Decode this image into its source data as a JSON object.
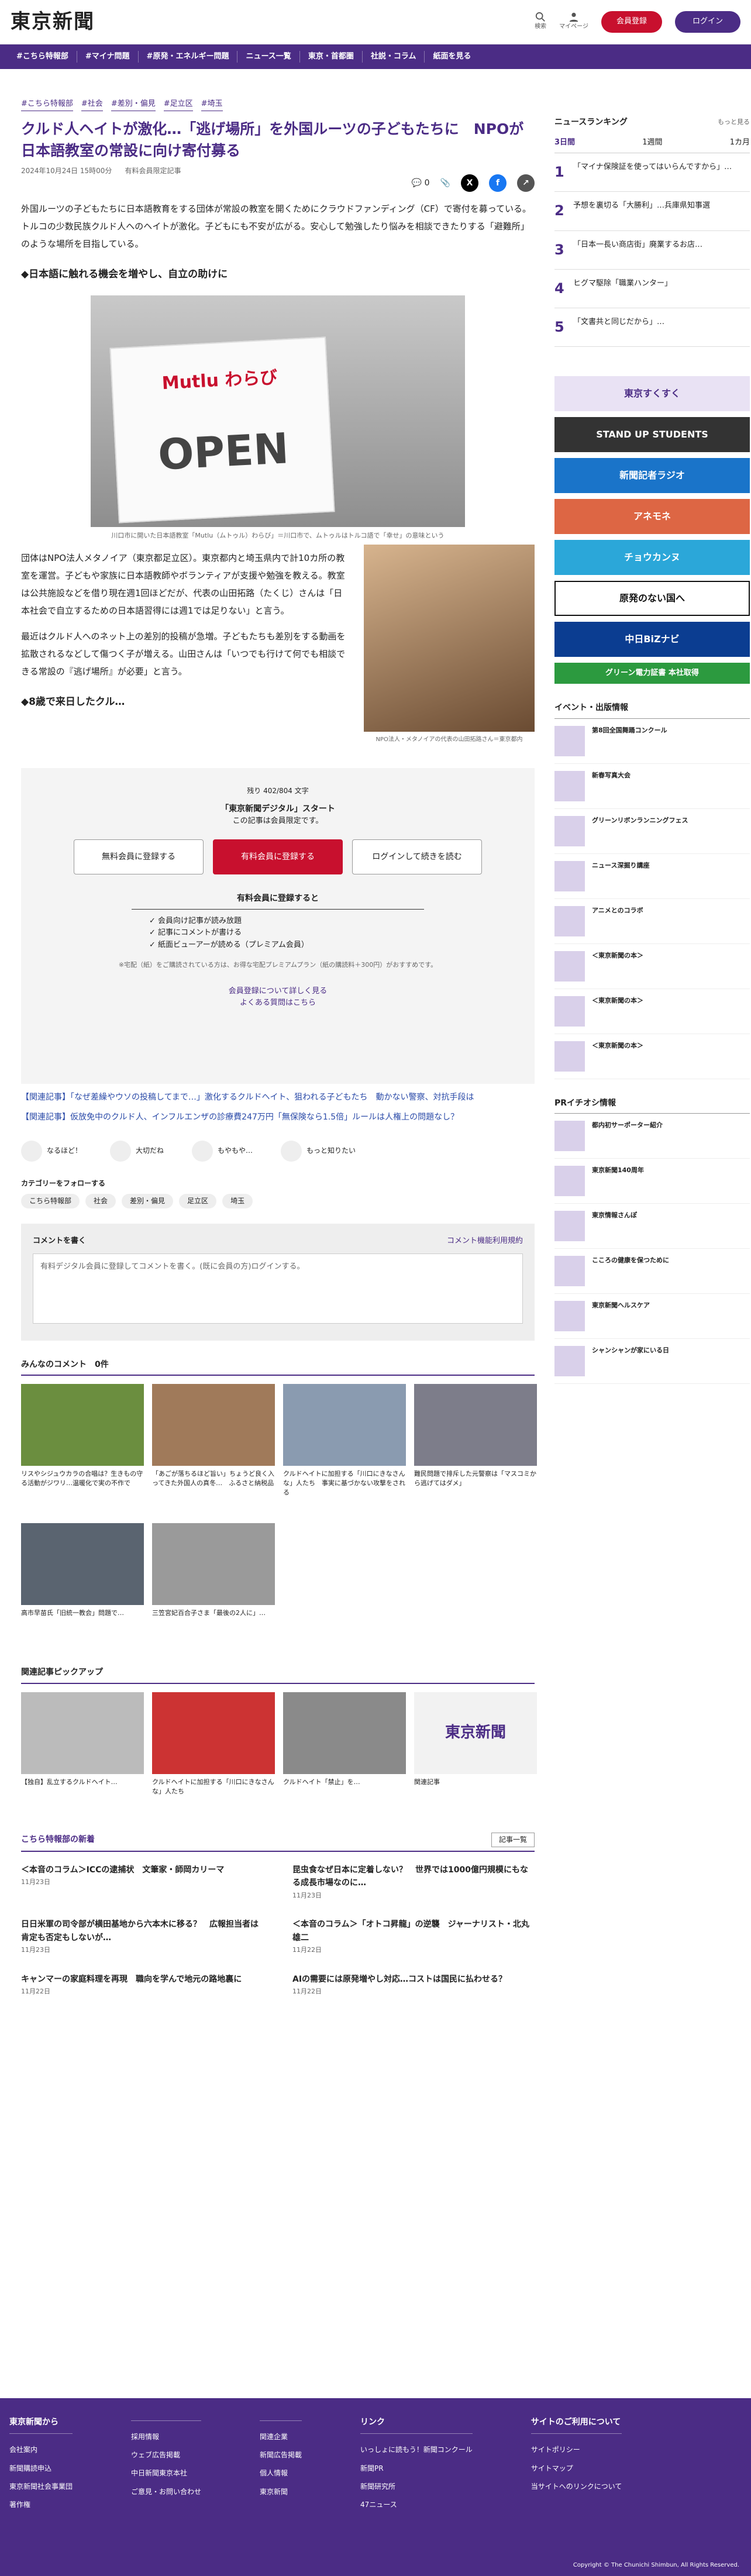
{
  "header": {
    "logo": "東京新聞",
    "search": "検索",
    "mypage": "マイページ",
    "register": "会員登録",
    "login": "ログイン"
  },
  "nav": [
    "#こちら特報部",
    "#マイナ問題",
    "#原発・エネルギー問題",
    "ニュース一覧",
    "東京・首都圏",
    "社説・コラム",
    "紙面を見る"
  ],
  "article": {
    "tags": [
      "#こちら特報部",
      "#社会",
      "#差別・偏見",
      "#足立区",
      "#埼玉"
    ],
    "title": "クルド人ヘイトが激化…「逃げ場所」を外国ルーツの子どもたちに　NPOが日本語教室の常設に向け寄付募る",
    "date": "2024年10月24日 15時00分",
    "limited": "有料会員限定記事",
    "comments": "0",
    "p1": "外国ルーツの子どもたちに日本語教育をする団体が常設の教室を開くためにクラウドファンディング（CF）で寄付を募っている。トルコの少数民族クルド人へのヘイトが激化。子どもにも不安が広がる。安心して勉強したり悩みを相談できたりする「避難所」のような場所を目指している。",
    "h1": "◆日本語に触れる機会を増やし、自立の助けに",
    "cap1": "川口市に開いた日本語教室「Mutlu（ムトゥル）わらび」＝川口市で、ムトゥルはトルコ語で「幸せ」の意味という",
    "p2": "団体はNPO法人メタノイア（東京都足立区）。東京都内と埼玉県内で計10カ所の教室を運営。子どもや家族に日本語教師やボランティアが支援や勉強を教える。教室は公共施設などを借り現在週1回ほどだが、代表の山田拓路（たくじ）さんは「日本社会で自立するための日本語習得には週1では足りない」と言う。",
    "p3": "最近はクルド人へのネット上の差別的投稿が急増。子どもたちも差別をする動画を拡散されるなどして傷つく子が増える。山田さんは「いつでも行けて何でも相談できる常設の『逃げ場所』が必要」と言う。",
    "cap2": "NPO法人・メタノイアの代表の山田拓路さん＝東京都内",
    "h2": "◆8歳で来日したクル…",
    "sign": "Mutlu わらび"
  },
  "paywall": {
    "remain": "残り 402/804 文字",
    "campaign": "「東京新聞デジタル」スタート",
    "note": "この記事は会員限定です。",
    "free": "無料会員に登録する",
    "paid": "有料会員に登録する",
    "login": "ログインして続きを読む",
    "benefits_title": "有料会員に登録すると",
    "benefits": [
      "会員向け記事が読み放題",
      "記事にコメントが書ける",
      "紙面ビューアーが読める（プレミアム会員）"
    ],
    "footnote": "※宅配（紙）をご購読されている方は、お得な宅配プレミアムプラン（紙の購読料＋300円）がおすすめです。",
    "more": "会員登録について詳しく見る",
    "faq": "よくある質問はこちら"
  },
  "related": [
    "【関連記事】「なぜ差繰やウソの投稿してまで…」激化するクルドヘイト、狙われる子どもたち　動かない警察、対抗手段は",
    "【関連記事】仮放免中のクルド人、インフルエンザの診療費247万円「無保険なら1.5倍」ルールは人権上の問題なし？"
  ],
  "reactions": [
    "なるほど！",
    "大切だね",
    "もやもや…",
    "もっと知りたい"
  ],
  "follow": {
    "title": "カテゴリーをフォローする",
    "chips": [
      "こちら特報部",
      "社会",
      "差別・偏見",
      "足立区",
      "埼玉"
    ]
  },
  "comment": {
    "title": "コメントを書く",
    "guide": "コメント機能利用規約",
    "hint": "有料デジタル会員に登録してコメントを書く。(既に会員の方)ログインする。"
  },
  "all_comments": "みんなのコメント　0件",
  "thumbs": [
    {
      "t": "リスやシジュウカラの合唱は？生きもの守る活動がジワリ…温暖化で実の不作で"
    },
    {
      "t": "「あごが落ちるほど旨い」ちょうど良く入ってきた外国人の真冬…　ふるさと納税品"
    },
    {
      "t": "クルドヘイトに加担する「川口にきなさんな」人たち　事実に基づかない攻撃をされる"
    },
    {
      "t": "難民問題で排斥した元警察は「マスコミから逃げてはダメ」"
    },
    {
      "t": "高市早苗氏「旧統一教会」問題で…"
    },
    {
      "t": "三笠宮妃百合子さま「最後の2人に」…"
    }
  ],
  "pickup": {
    "title": "関連記事ピックアップ",
    "items": [
      "【独自】乱立するクルドヘイト…",
      "クルドヘイトに加担する「川口にきなさんな」人たち",
      "クルドヘイト「禁止」を…",
      "関連記事"
    ]
  },
  "special": {
    "title": "こちら特報部の新着",
    "more": "記事一覧",
    "items": [
      {
        "h": "＜本音のコラム＞ICCの逮捕状　文筆家・師岡カリーマ",
        "d": "11月23日"
      },
      {
        "h": "昆虫食なぜ日本に定着しない？　世界では1000億円規模にもなる成長市場なのに…",
        "d": "11月23日"
      },
      {
        "h": "日日米軍の司令部が横田基地から六本木に移る？　広報担当者は肯定も否定もしないが…",
        "d": "11月23日"
      },
      {
        "h": "＜本音のコラム＞「オトコ昇龍」の逆襲　ジャーナリスト・北丸雄二",
        "d": "11月22日"
      },
      {
        "h": "キャンマーの家庭料理を再現　職向を学んで地元の路地裏に",
        "d": "11月22日"
      },
      {
        "h": "AIの需要には原発増やし対応…コストは国民に払わせる？",
        "d": "11月22日"
      }
    ]
  },
  "ranking": {
    "title": "ニュースランキング",
    "more": "もっと見る",
    "tabs": [
      "3日間",
      "1週間",
      "1カ月"
    ],
    "items": [
      "「マイナ保険証を使ってはいらんですから」…",
      "予想を裏切る「大勝利」…兵庫県知事選",
      "「日本一長い商店街」廃業するお店…",
      "ヒグマ駆除「職業ハンター」",
      "「文書共と同じだから」…"
    ]
  },
  "banners": [
    "東京すくすく",
    "STAND UP STUDENTS",
    "新聞記者ラジオ",
    "アネモネ",
    "チョウカンヌ",
    "原発のない国へ",
    "中日BiZナビ",
    "グリーン電力証書 本社取得"
  ],
  "events": {
    "title": "イベント・出版情報",
    "items": [
      "第8回全国舞踊コンクール",
      "新春写真大会",
      "グリーンリボンランニングフェス",
      "ニュース深掘り講座",
      "アニメとのコラボ",
      "＜東京新聞の本＞",
      "＜東京新聞の本＞",
      "＜東京新聞の本＞"
    ]
  },
  "pr": {
    "title": "PRイチオシ情報",
    "items": [
      "都内初サーポーター紹介",
      "東京新聞140周年",
      "東京情報さんぽ",
      "こころの健康を保つために",
      "東京新聞ヘルスケア",
      "シャンシャンが家にいる日"
    ]
  },
  "footer": {
    "cols": [
      {
        "h": "東京新聞から",
        "items": [
          "会社案内",
          "新聞購読申込",
          "東京新聞社会事業団",
          "著作権"
        ]
      },
      {
        "h": "",
        "items": [
          "採用情報",
          "ウェブ広告掲載",
          "中日新聞東京本社",
          "ご意見・お問い合わせ"
        ]
      },
      {
        "h": "",
        "items": [
          "関連企業",
          "新聞広告掲載",
          "個人情報",
          "東京新聞"
        ]
      },
      {
        "h": "リンク",
        "items": [
          "いっしょに読もう！新聞コンクール",
          "新聞PR",
          "新聞研究所",
          "47ニュース"
        ]
      },
      {
        "h": "サイトのご利用について",
        "items": [
          "サイトポリシー",
          "サイトマップ",
          "当サイトへのリンクについて"
        ]
      }
    ],
    "copy": "Copyright © The Chunichi Shimbun, All Rights Reserved."
  }
}
